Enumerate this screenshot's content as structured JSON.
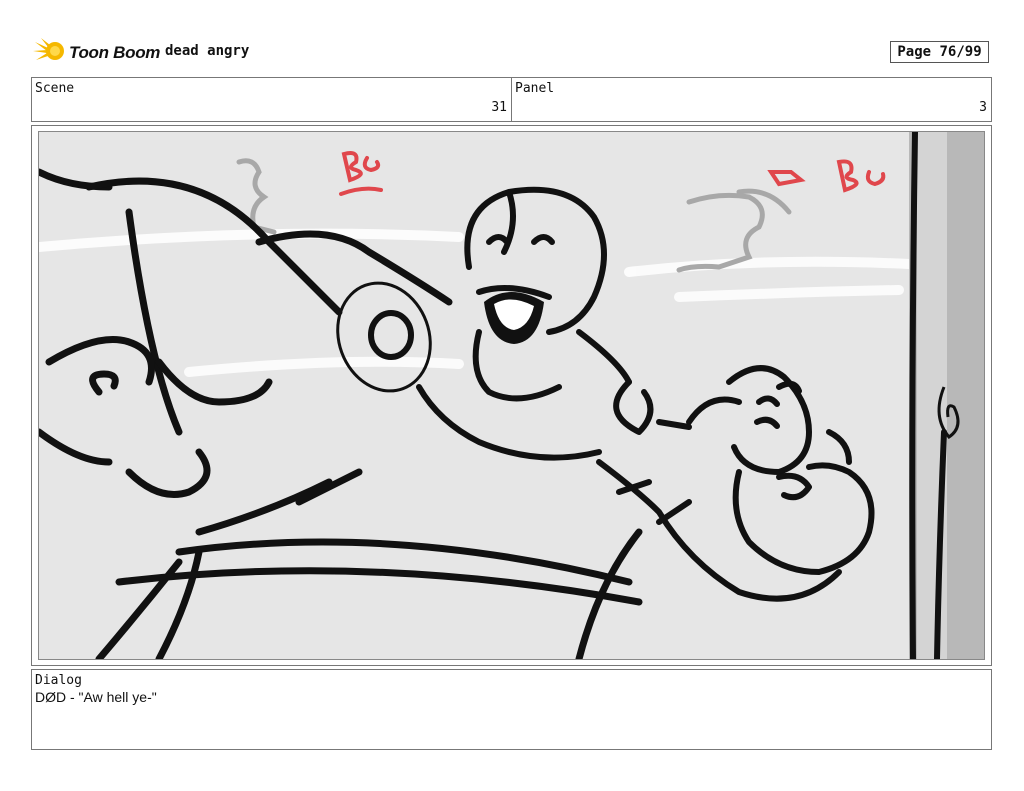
{
  "header": {
    "logo_text": "Toon Boom",
    "project_title": "dead angry",
    "page_label": "Page 76/99"
  },
  "scene": {
    "label": "Scene",
    "value": "31"
  },
  "panel": {
    "label": "Panel",
    "value": "3"
  },
  "dialog": {
    "label": "Dialog",
    "text": "DØD - \"Aw hell ye-\""
  },
  "colors": {
    "logo_accent": "#f5b800",
    "sketch_line": "#111111",
    "bg_note_red": "#e0474c",
    "panel_background": "#e6e6e6",
    "rough_gray": "#a8a8a8"
  },
  "icons": {
    "logo": "toon-boom-logo-icon"
  }
}
